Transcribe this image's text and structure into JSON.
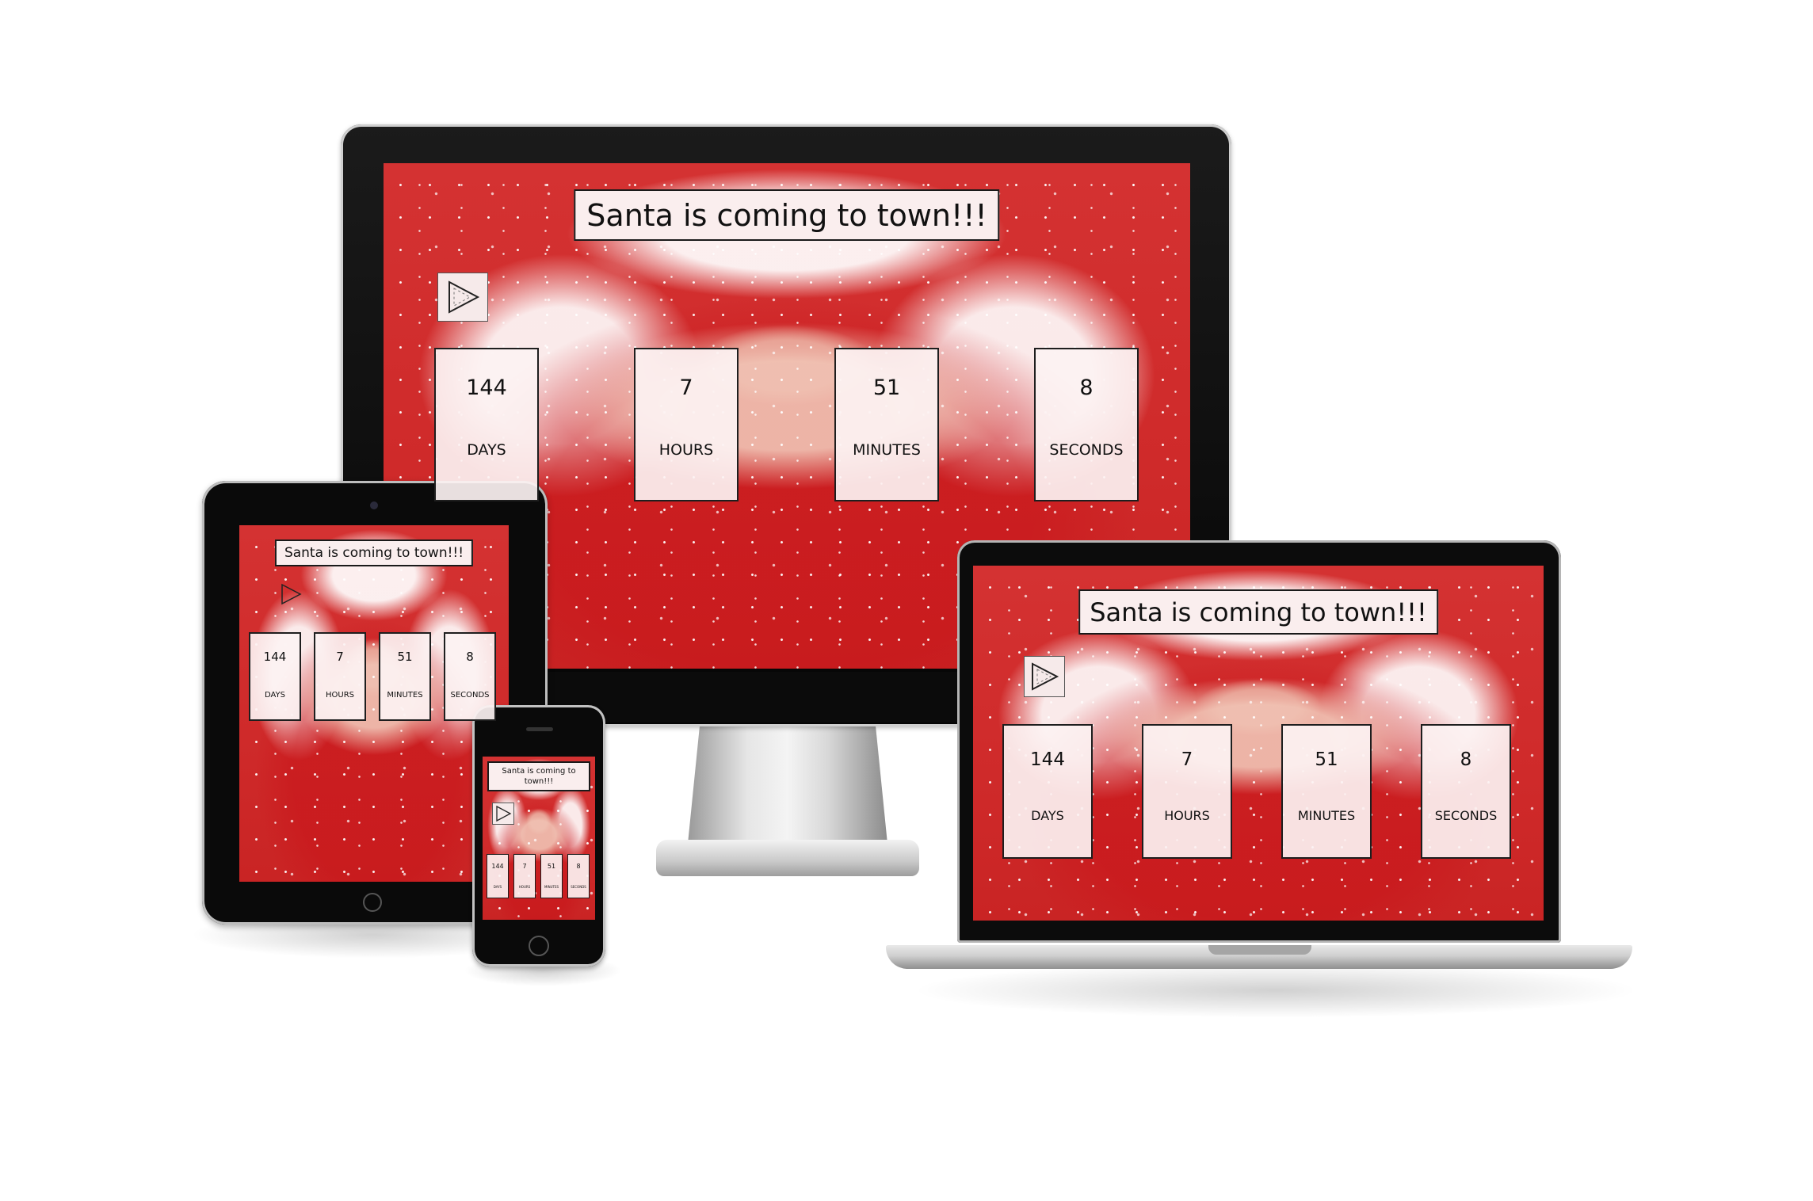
{
  "site": {
    "title": "Santa is coming to town!!!",
    "countdown": [
      {
        "value": "144",
        "label": "DAYS"
      },
      {
        "value": "7",
        "label": "HOURS"
      },
      {
        "value": "51",
        "label": "MINUTES"
      },
      {
        "value": "8",
        "label": "SECONDS"
      }
    ],
    "play_icon": "play-icon"
  },
  "devices": [
    "desktop-monitor",
    "tablet",
    "laptop",
    "phone"
  ],
  "colors": {
    "site_background": "#cf2a2a",
    "title_background": "#faeeee",
    "box_border": "#1e1e1e",
    "device_bezel": "#0b0b0b",
    "device_silver": "#c8c8c8"
  }
}
